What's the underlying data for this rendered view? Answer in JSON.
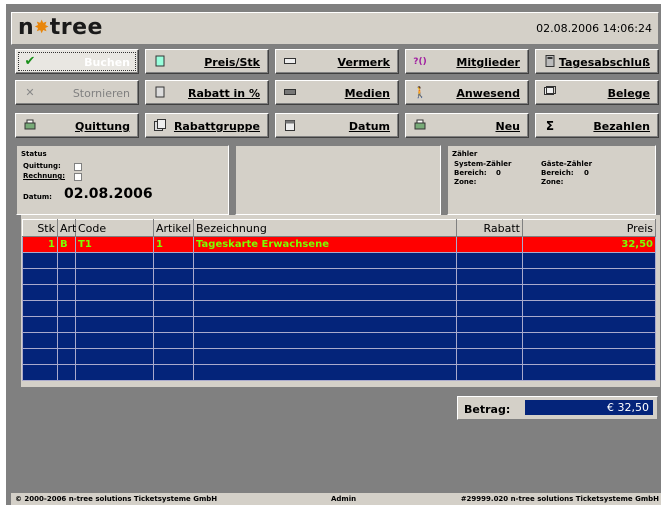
{
  "header": {
    "logo_n": "n",
    "logo_star": "✸",
    "logo_tree": "tree",
    "datetime": "02.08.2006 14:06:24"
  },
  "buttons": [
    {
      "label": "Buchen",
      "icon": "check-icon"
    },
    {
      "label": "Preis/Stk",
      "icon": "price-icon"
    },
    {
      "label": "Vermerk",
      "icon": "note-icon"
    },
    {
      "label": "Mitglieder",
      "icon": "members-icon"
    },
    {
      "label": "Tagesabschluß",
      "icon": "calculator-icon"
    },
    {
      "label": "Stornieren",
      "icon": "cancel-icon"
    },
    {
      "label": "Rabatt in %",
      "icon": "discount-icon"
    },
    {
      "label": "Medien",
      "icon": "media-icon"
    },
    {
      "label": "Anwesend",
      "icon": "person-icon"
    },
    {
      "label": "Belege",
      "icon": "receipts-icon"
    },
    {
      "label": "Quittung",
      "icon": "printer-icon"
    },
    {
      "label": "Rabattgruppe",
      "icon": "discount-group-icon"
    },
    {
      "label": "Datum",
      "icon": "calendar-icon"
    },
    {
      "label": "Neu",
      "icon": "new-icon"
    },
    {
      "label": "Bezahlen",
      "icon": "sum-icon"
    }
  ],
  "status": {
    "title": "Status",
    "quittung_label": "Quittung:",
    "rechnung_label": "Rechnung:",
    "datum_label": "Datum:",
    "datum_value": "02.08.2006"
  },
  "zaehler": {
    "title": "Zähler",
    "system_label": "System-Zähler",
    "gaeste_label": "Gäste-Zähler",
    "bereich_label": "Bereich:",
    "system_bereich": "0",
    "gaeste_bereich": "0",
    "zone_label": "Zone:"
  },
  "table": {
    "headers": {
      "stk": "Stk",
      "art": "Art",
      "code": "Code",
      "artikel": "Artikel",
      "bezeichnung": "Bezeichnung",
      "rabatt": "Rabatt",
      "preis": "Preis"
    },
    "rows": [
      {
        "stk": "1",
        "art": "B",
        "code": "T1",
        "artikel": "1",
        "bezeichnung": "Tageskarte Erwachsene",
        "rabatt": "",
        "preis": "32,50"
      }
    ]
  },
  "betrag": {
    "label": "Betrag:",
    "value": "€ 32,50"
  },
  "statusbar": {
    "copyright": "© 2000-2006 n-tree solutions Ticketsysteme GmbH",
    "user": "Admin",
    "license": "#29999.020 n-tree solutions Ticketsysteme GmbH"
  },
  "colors": {
    "selected_row": "#ff0000",
    "row_text": "#7cff00",
    "table_bg": "#04247a",
    "accent": "#e8860b"
  }
}
